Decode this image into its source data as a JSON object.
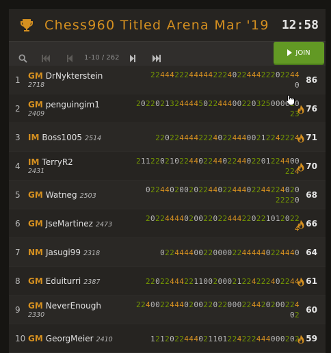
{
  "header": {
    "title": "Chess960 Titled Arena Mar '19",
    "clock": "12:58",
    "icon": "trophy-icon"
  },
  "pager": {
    "text": "1-10 / 262",
    "join_label": "JOIN"
  },
  "colors": {
    "accent": "#d59020",
    "green": "#759900",
    "join_button": "#629924",
    "background": "#262421"
  },
  "standings": [
    {
      "rank": "1",
      "title": "GM",
      "name": "DrNykterstein",
      "rating": "2718",
      "sheet": [
        "2244422244444222402244422202244",
        "0"
      ],
      "score": "86",
      "fire": false,
      "rating_below": true
    },
    {
      "rank": "2",
      "title": "GM",
      "name": "penguingim1",
      "rating": "2409",
      "sheet": [
        "2022021324444502244400220325000020",
        "23"
      ],
      "score": "76",
      "fire": true,
      "rating_below": true
    },
    {
      "rank": "3",
      "title": "IM",
      "name": "Boss1005",
      "rating": "2514",
      "sheet": [
        "220224444222402244400212242224",
        ""
      ],
      "score": "71",
      "fire": true,
      "rating_below": false
    },
    {
      "rank": "4",
      "title": "IM",
      "name": "TerryR2",
      "rating": "2431",
      "sheet": [
        "2112202102244022440224402201224400",
        "224"
      ],
      "score": "70",
      "fire": true,
      "rating_below": true
    },
    {
      "rank": "5",
      "title": "GM",
      "name": "Watneg",
      "rating": "2503",
      "sheet": [
        "02244020020224402244402244224020",
        "22220"
      ],
      "score": "68",
      "fire": false,
      "rating_below": false
    },
    {
      "rank": "6",
      "title": "GM",
      "name": "JseMartinez",
      "rating": "2473",
      "sheet": [
        "20224444020022022444220221012022",
        "4"
      ],
      "score": "66",
      "fire": true,
      "rating_below": false
    },
    {
      "rank": "7",
      "title": "NM",
      "name": "Jasugi99",
      "rating": "2318",
      "sheet": [
        "02244440022000022444440224440",
        ""
      ],
      "score": "64",
      "fire": false,
      "rating_below": false
    },
    {
      "rank": "8",
      "title": "GM",
      "name": "Eduiturri",
      "rating": "2387",
      "sheet": [
        "22022444221100200021224222402244",
        ""
      ],
      "score": "61",
      "fire": true,
      "rating_below": false
    },
    {
      "rank": "9",
      "title": "GM",
      "name": "NeverEnough",
      "rating": "2330",
      "sheet": [
        "2240022444020022022000224420200224",
        "02"
      ],
      "score": "60",
      "fire": false,
      "rating_below": true
    },
    {
      "rank": "10",
      "title": "GM",
      "name": "GeorgMeier",
      "rating": "2410",
      "sheet": [
        "1212022444021101224222444000202",
        ""
      ],
      "score": "59",
      "fire": true,
      "rating_below": false
    }
  ]
}
